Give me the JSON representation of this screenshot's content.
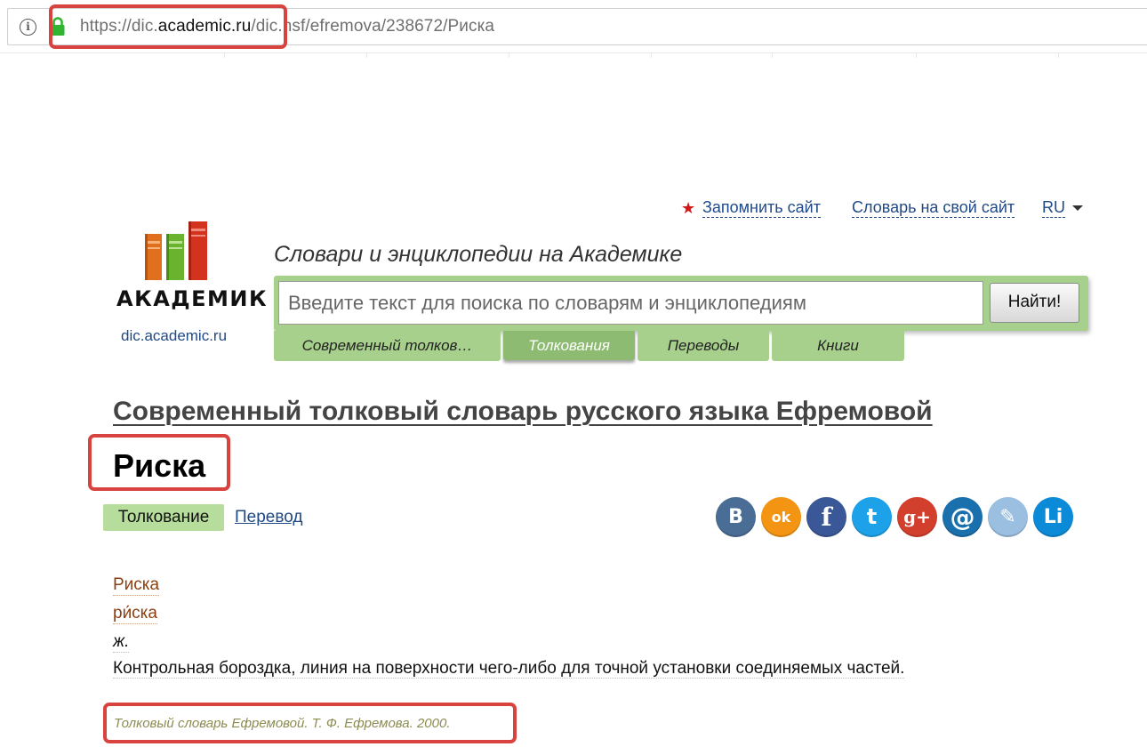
{
  "browser": {
    "url_prefix": "https://dic.",
    "url_domain": "academic.ru",
    "url_path": "/dic.nsf/efremova/238672/Риска"
  },
  "toplinks": {
    "remember": "Запомнить сайт",
    "dictionary_for_site": "Словарь на свой сайт",
    "language": "RU"
  },
  "logo": {
    "word": "АКАДЕМИК",
    "site": "dic.academic.ru"
  },
  "search": {
    "tagline": "Словари и энциклопедии на Академике",
    "placeholder": "Введите текст для поиска по словарям и энциклопедиям",
    "button": "Найти!",
    "tabs": [
      {
        "label": "Современный толков…",
        "active": false
      },
      {
        "label": "Толкования",
        "active": true
      },
      {
        "label": "Переводы",
        "active": false
      },
      {
        "label": "Книги",
        "active": false
      }
    ]
  },
  "article": {
    "dictionary_title": "Современный толковый словарь русского языка Ефремовой",
    "word": "Риска",
    "tab_interpretation": "Толкование",
    "tab_translation": "Перевод",
    "entry_headword": "Риска",
    "entry_accented": "ри́ска",
    "entry_gender": "ж.",
    "entry_definition": "Контрольная бороздка, линия на поверхности чего-либо для точной установки соединяемых частей.",
    "source": "Толковый словарь Ефремовой. Т. Ф. Ефремова. 2000."
  },
  "social": [
    {
      "name": "vkontakte-icon",
      "glyph": "B",
      "color": "#4a6d95"
    },
    {
      "name": "odnoklassniki-icon",
      "glyph": "ok",
      "color": "#f39512"
    },
    {
      "name": "facebook-icon",
      "glyph": "f",
      "color": "#3a5897"
    },
    {
      "name": "twitter-icon",
      "glyph": "t",
      "color": "#1da1e8"
    },
    {
      "name": "google-plus-icon",
      "glyph": "g+",
      "color": "#d23f2d"
    },
    {
      "name": "mail-icon",
      "glyph": "@",
      "color": "#1a6fad"
    },
    {
      "name": "livejournal-icon",
      "glyph": "✎",
      "color": "#9abfe0"
    },
    {
      "name": "liveinternet-icon",
      "glyph": "Li",
      "color": "#0b8ad8"
    }
  ]
}
